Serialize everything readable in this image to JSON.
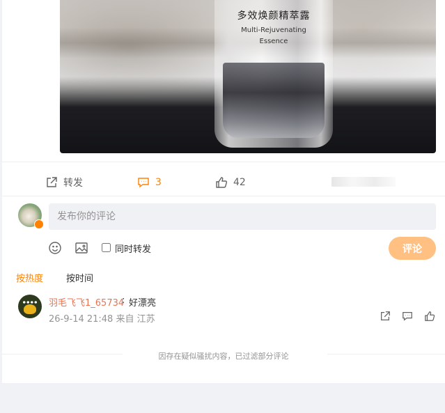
{
  "post": {
    "image": {
      "bottle_title": "多效焕颜精萃露",
      "bottle_subtitle_line1": "Multi-Rejuvenating",
      "bottle_subtitle_line2": "Essence"
    },
    "actions": {
      "repost_label": "转发",
      "comment_count": "3",
      "like_count": "42"
    }
  },
  "composer": {
    "placeholder": "发布你的评论",
    "repost_checkbox_label": "同时转发",
    "submit_label": "评论",
    "icons": [
      "emoji-icon",
      "image-icon"
    ]
  },
  "sort": {
    "hot_label": "按热度",
    "time_label": "按时间"
  },
  "comments": [
    {
      "username": "羽毛飞飞1_65734",
      "colon": ":",
      "text": "好漂亮",
      "meta": "26-9-14 21:48 来自 江苏"
    }
  ],
  "filter_note": "因存在疑似骚扰内容，已过滤部分评论",
  "colors": {
    "accent": "#ff8200",
    "username": "#eb7350",
    "submit_disabled": "#ffc081",
    "muted": "#939393"
  }
}
